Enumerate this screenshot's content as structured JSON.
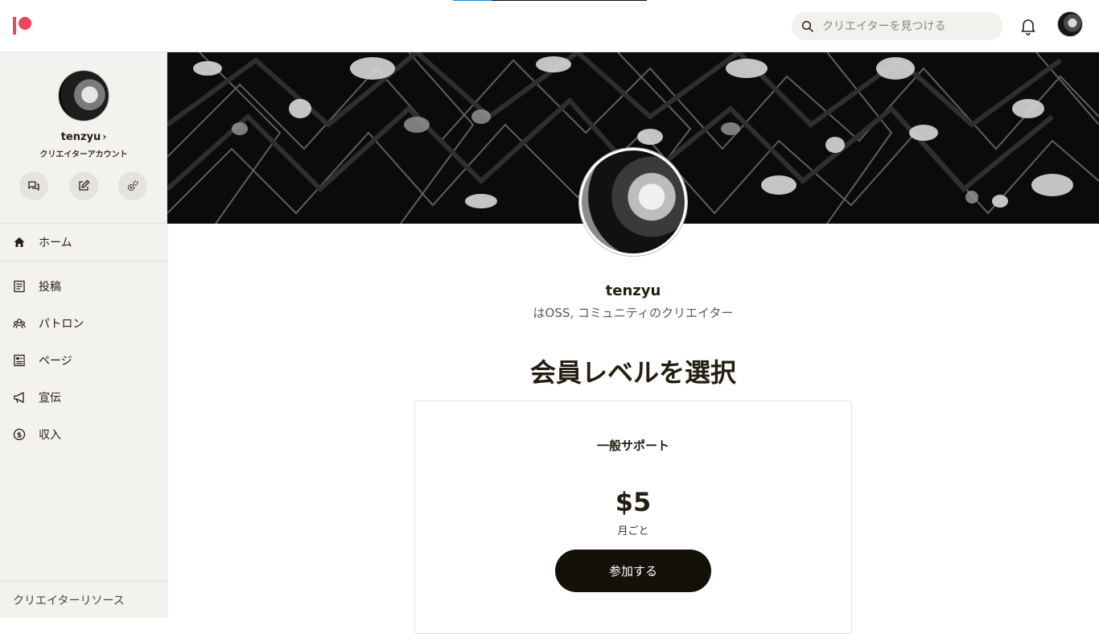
{
  "header": {
    "search_placeholder": "クリエイターを見つける",
    "icons": [
      "patreon-logo-icon",
      "search-icon",
      "bell-icon"
    ]
  },
  "sidebar": {
    "creator_name": "tenzyu",
    "creator_name_chevron": "›",
    "account_type": "クリエイターアカウント",
    "quick_actions": [
      "chat-icon",
      "edit-icon",
      "settings-icon"
    ],
    "nav": [
      {
        "label": "ホーム",
        "icon": "home-icon"
      },
      {
        "label": "投稿",
        "icon": "posts-icon"
      },
      {
        "label": "パトロン",
        "icon": "patrons-icon"
      },
      {
        "label": "ページ",
        "icon": "page-icon"
      },
      {
        "label": "宣伝",
        "icon": "megaphone-icon"
      },
      {
        "label": "収入",
        "icon": "dollar-icon"
      }
    ],
    "footer_label": "クリエイターリソース"
  },
  "profile": {
    "name": "tenzyu",
    "tagline": "はOSS, コミュニティのクリエイター"
  },
  "tiers_section": {
    "title": "会員レベルを選択",
    "tiers": [
      {
        "name": "一般サポート",
        "price": "$5",
        "period": "月ごと",
        "join_label": "参加する"
      }
    ]
  },
  "colors": {
    "brand": "#f1465a",
    "button_dark": "#141109",
    "sidebar_bg": "#f3f2ef",
    "progress_blue": "#1e8ad6"
  }
}
